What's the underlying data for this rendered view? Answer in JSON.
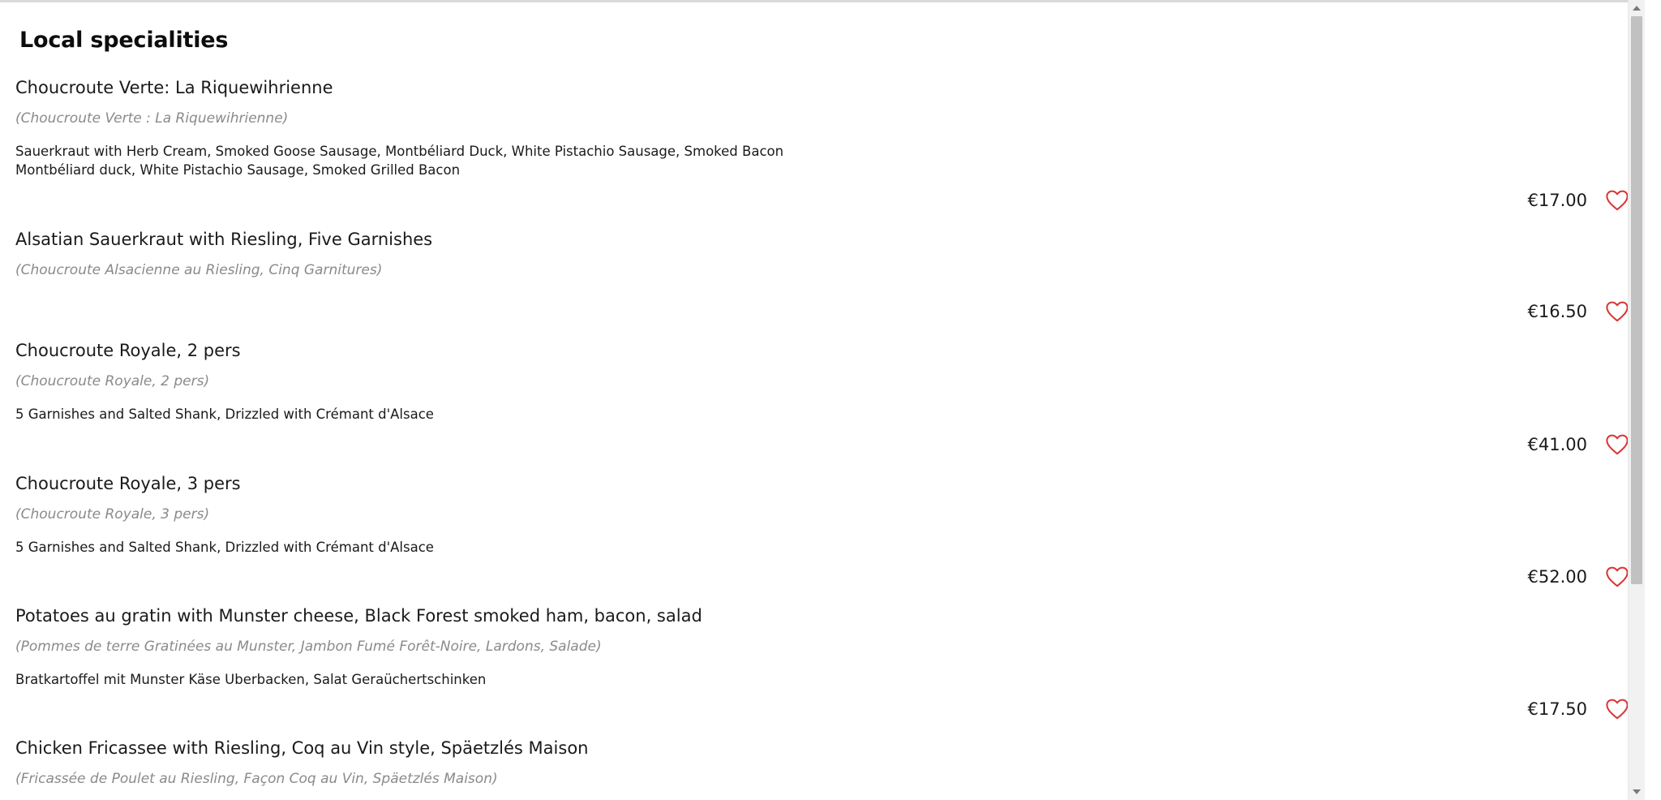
{
  "section": {
    "title": "Local specialities"
  },
  "colors": {
    "heart": "#d93636",
    "original_text": "#8a8a8a",
    "scrollbar_thumb": "#c1c1c1"
  },
  "icons": {
    "favorite": "heart-outline-icon",
    "scroll_up": "triangle-up-icon",
    "scroll_down": "triangle-down-icon"
  },
  "items": [
    {
      "name": "Choucroute Verte: La Riquewihrienne",
      "original": "(Choucroute Verte : La Riquewihrienne)",
      "description": [
        "Sauerkraut with Herb Cream, Smoked Goose Sausage, Montbéliard Duck, White Pistachio Sausage, Smoked Bacon",
        "Montbéliard duck, White Pistachio Sausage, Smoked Grilled Bacon"
      ],
      "price": "€17.00"
    },
    {
      "name": "Alsatian Sauerkraut with Riesling, Five Garnishes",
      "original": "(Choucroute Alsacienne au Riesling, Cinq Garnitures)",
      "description": [],
      "price": "€16.50"
    },
    {
      "name": "Choucroute Royale, 2 pers",
      "original": "(Choucroute Royale, 2 pers)",
      "description": [
        "5 Garnishes and Salted Shank, Drizzled with Crémant d'Alsace"
      ],
      "price": "€41.00"
    },
    {
      "name": "Choucroute Royale, 3 pers",
      "original": "(Choucroute Royale, 3 pers)",
      "description": [
        "5 Garnishes and Salted Shank, Drizzled with Crémant d'Alsace"
      ],
      "price": "€52.00"
    },
    {
      "name": "Potatoes au gratin with Munster cheese, Black Forest smoked ham, bacon, salad",
      "original": "(Pommes de terre Gratinées au Munster, Jambon Fumé Forêt-Noire, Lardons, Salade)",
      "description": [
        "Bratkartoffel mit Munster Käse Uberbacken, Salat Geraüchertschinken"
      ],
      "price": "€17.50"
    },
    {
      "name": "Chicken Fricassee with Riesling, Coq au Vin style, Späetzlés Maison",
      "original": "(Fricassée de Poulet au Riesling, Façon Coq au Vin, Späetzlés Maison)",
      "description": [],
      "price": ""
    }
  ]
}
